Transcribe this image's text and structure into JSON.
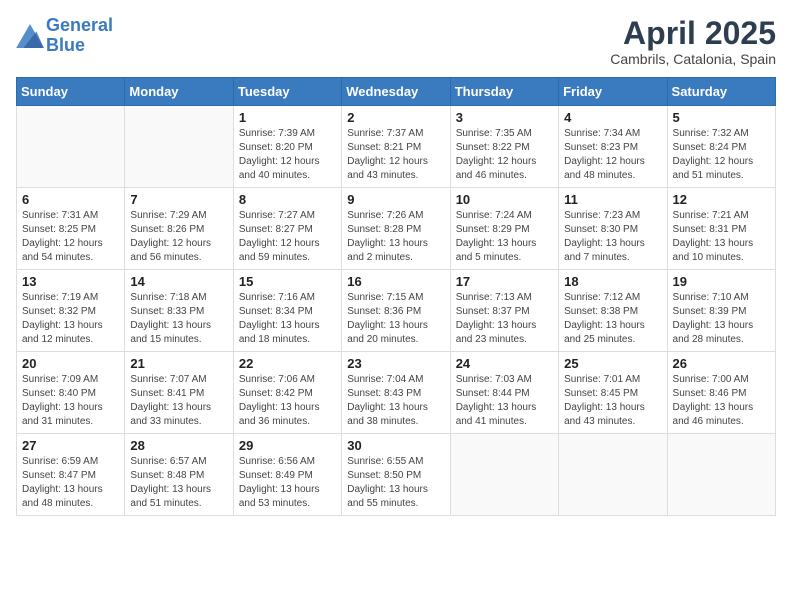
{
  "header": {
    "logo_line1": "General",
    "logo_line2": "Blue",
    "month": "April 2025",
    "location": "Cambrils, Catalonia, Spain"
  },
  "weekdays": [
    "Sunday",
    "Monday",
    "Tuesday",
    "Wednesday",
    "Thursday",
    "Friday",
    "Saturday"
  ],
  "weeks": [
    [
      {
        "day": "",
        "info": ""
      },
      {
        "day": "",
        "info": ""
      },
      {
        "day": "1",
        "info": "Sunrise: 7:39 AM\nSunset: 8:20 PM\nDaylight: 12 hours and 40 minutes."
      },
      {
        "day": "2",
        "info": "Sunrise: 7:37 AM\nSunset: 8:21 PM\nDaylight: 12 hours and 43 minutes."
      },
      {
        "day": "3",
        "info": "Sunrise: 7:35 AM\nSunset: 8:22 PM\nDaylight: 12 hours and 46 minutes."
      },
      {
        "day": "4",
        "info": "Sunrise: 7:34 AM\nSunset: 8:23 PM\nDaylight: 12 hours and 48 minutes."
      },
      {
        "day": "5",
        "info": "Sunrise: 7:32 AM\nSunset: 8:24 PM\nDaylight: 12 hours and 51 minutes."
      }
    ],
    [
      {
        "day": "6",
        "info": "Sunrise: 7:31 AM\nSunset: 8:25 PM\nDaylight: 12 hours and 54 minutes."
      },
      {
        "day": "7",
        "info": "Sunrise: 7:29 AM\nSunset: 8:26 PM\nDaylight: 12 hours and 56 minutes."
      },
      {
        "day": "8",
        "info": "Sunrise: 7:27 AM\nSunset: 8:27 PM\nDaylight: 12 hours and 59 minutes."
      },
      {
        "day": "9",
        "info": "Sunrise: 7:26 AM\nSunset: 8:28 PM\nDaylight: 13 hours and 2 minutes."
      },
      {
        "day": "10",
        "info": "Sunrise: 7:24 AM\nSunset: 8:29 PM\nDaylight: 13 hours and 5 minutes."
      },
      {
        "day": "11",
        "info": "Sunrise: 7:23 AM\nSunset: 8:30 PM\nDaylight: 13 hours and 7 minutes."
      },
      {
        "day": "12",
        "info": "Sunrise: 7:21 AM\nSunset: 8:31 PM\nDaylight: 13 hours and 10 minutes."
      }
    ],
    [
      {
        "day": "13",
        "info": "Sunrise: 7:19 AM\nSunset: 8:32 PM\nDaylight: 13 hours and 12 minutes."
      },
      {
        "day": "14",
        "info": "Sunrise: 7:18 AM\nSunset: 8:33 PM\nDaylight: 13 hours and 15 minutes."
      },
      {
        "day": "15",
        "info": "Sunrise: 7:16 AM\nSunset: 8:34 PM\nDaylight: 13 hours and 18 minutes."
      },
      {
        "day": "16",
        "info": "Sunrise: 7:15 AM\nSunset: 8:36 PM\nDaylight: 13 hours and 20 minutes."
      },
      {
        "day": "17",
        "info": "Sunrise: 7:13 AM\nSunset: 8:37 PM\nDaylight: 13 hours and 23 minutes."
      },
      {
        "day": "18",
        "info": "Sunrise: 7:12 AM\nSunset: 8:38 PM\nDaylight: 13 hours and 25 minutes."
      },
      {
        "day": "19",
        "info": "Sunrise: 7:10 AM\nSunset: 8:39 PM\nDaylight: 13 hours and 28 minutes."
      }
    ],
    [
      {
        "day": "20",
        "info": "Sunrise: 7:09 AM\nSunset: 8:40 PM\nDaylight: 13 hours and 31 minutes."
      },
      {
        "day": "21",
        "info": "Sunrise: 7:07 AM\nSunset: 8:41 PM\nDaylight: 13 hours and 33 minutes."
      },
      {
        "day": "22",
        "info": "Sunrise: 7:06 AM\nSunset: 8:42 PM\nDaylight: 13 hours and 36 minutes."
      },
      {
        "day": "23",
        "info": "Sunrise: 7:04 AM\nSunset: 8:43 PM\nDaylight: 13 hours and 38 minutes."
      },
      {
        "day": "24",
        "info": "Sunrise: 7:03 AM\nSunset: 8:44 PM\nDaylight: 13 hours and 41 minutes."
      },
      {
        "day": "25",
        "info": "Sunrise: 7:01 AM\nSunset: 8:45 PM\nDaylight: 13 hours and 43 minutes."
      },
      {
        "day": "26",
        "info": "Sunrise: 7:00 AM\nSunset: 8:46 PM\nDaylight: 13 hours and 46 minutes."
      }
    ],
    [
      {
        "day": "27",
        "info": "Sunrise: 6:59 AM\nSunset: 8:47 PM\nDaylight: 13 hours and 48 minutes."
      },
      {
        "day": "28",
        "info": "Sunrise: 6:57 AM\nSunset: 8:48 PM\nDaylight: 13 hours and 51 minutes."
      },
      {
        "day": "29",
        "info": "Sunrise: 6:56 AM\nSunset: 8:49 PM\nDaylight: 13 hours and 53 minutes."
      },
      {
        "day": "30",
        "info": "Sunrise: 6:55 AM\nSunset: 8:50 PM\nDaylight: 13 hours and 55 minutes."
      },
      {
        "day": "",
        "info": ""
      },
      {
        "day": "",
        "info": ""
      },
      {
        "day": "",
        "info": ""
      }
    ]
  ]
}
